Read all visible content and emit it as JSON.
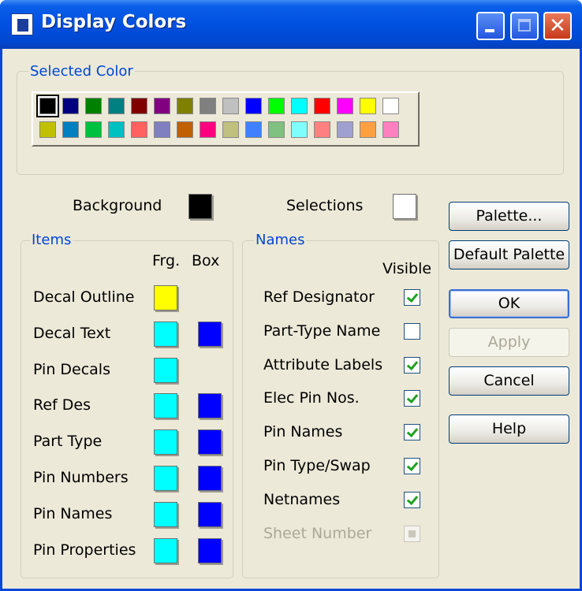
{
  "window": {
    "title": "Display Colors"
  },
  "selected_color": {
    "label": "Selected Color",
    "row1": [
      "#000000",
      "#000080",
      "#008000",
      "#008080",
      "#800000",
      "#800080",
      "#808000",
      "#808080",
      "#c0c0c0",
      "#0000ff",
      "#00ff00",
      "#00ffff",
      "#ff0000",
      "#ff00ff",
      "#ffff00",
      "#ffffff"
    ],
    "row2": [
      "#c0c000",
      "#0080c0",
      "#00c040",
      "#00c0c0",
      "#ff6060",
      "#8080c0",
      "#c06000",
      "#ff0080",
      "#c0c080",
      "#4080ff",
      "#80c080",
      "#80ffff",
      "#ff8080",
      "#a0a0d0",
      "#ffa040",
      "#ff80c0"
    ]
  },
  "background": {
    "label": "Background",
    "color": "#000000"
  },
  "selections": {
    "label": "Selections",
    "color": "#ffffff"
  },
  "items": {
    "label": "Items",
    "col_frg": "Frg.",
    "col_box": "Box",
    "rows": [
      {
        "label": "Decal Outline",
        "frg": "#ffff00",
        "box": null
      },
      {
        "label": "Decal Text",
        "frg": "#00ffff",
        "box": "#0000ff"
      },
      {
        "label": "Pin Decals",
        "frg": "#00ffff",
        "box": null
      },
      {
        "label": "Ref Des",
        "frg": "#00ffff",
        "box": "#0000ff"
      },
      {
        "label": "Part Type",
        "frg": "#00ffff",
        "box": "#0000ff"
      },
      {
        "label": "Pin Numbers",
        "frg": "#00ffff",
        "box": "#0000ff"
      },
      {
        "label": "Pin Names",
        "frg": "#00ffff",
        "box": "#0000ff"
      },
      {
        "label": "Pin Properties",
        "frg": "#00ffff",
        "box": "#0000ff"
      }
    ]
  },
  "names": {
    "label": "Names",
    "col_visible": "Visible",
    "rows": [
      {
        "label": "Ref  Designator",
        "checked": true,
        "enabled": true
      },
      {
        "label": "Part-Type Name",
        "checked": false,
        "enabled": true
      },
      {
        "label": "Attribute Labels",
        "checked": true,
        "enabled": true
      },
      {
        "label": "Elec Pin Nos.",
        "checked": true,
        "enabled": true
      },
      {
        "label": "Pin Names",
        "checked": true,
        "enabled": true
      },
      {
        "label": "Pin Type/Swap",
        "checked": true,
        "enabled": true
      },
      {
        "label": "Netnames",
        "checked": true,
        "enabled": true
      },
      {
        "label": "Sheet Number",
        "checked": false,
        "enabled": false
      }
    ]
  },
  "buttons": {
    "palette": "Palette...",
    "default_palette": "Default Palette",
    "ok": "OK",
    "apply": "Apply",
    "cancel": "Cancel",
    "help": "Help"
  }
}
